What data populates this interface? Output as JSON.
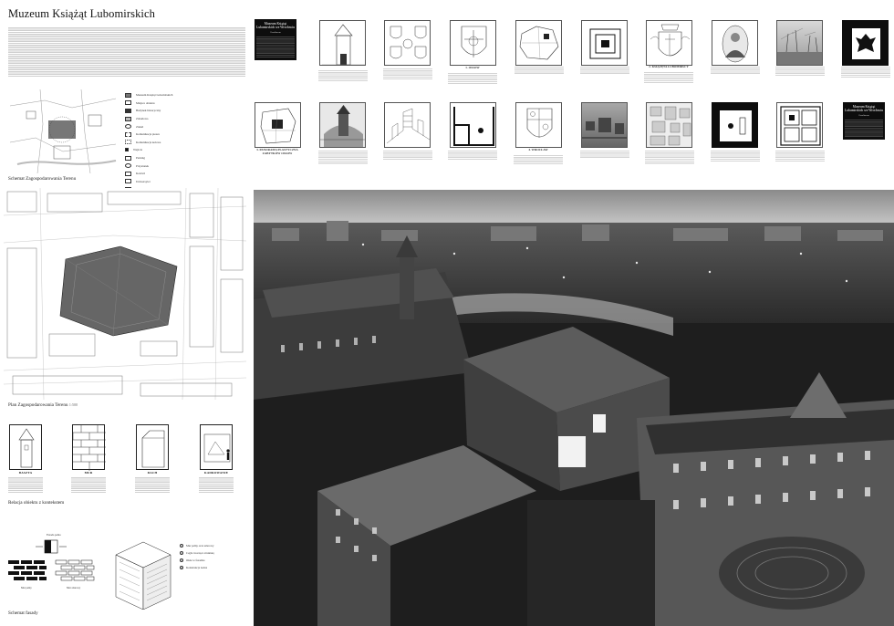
{
  "poster": {
    "title": "Muzeum Książąt Lubomirskich",
    "intro_placeholder": "Wprowadzenie / tekst opisowy"
  },
  "left": {
    "schemat_caption": "Schemat  Zagospodarowania Terenu",
    "plan_caption": "Plan Zagospodarowania Terenu",
    "plan_scale": "1:500",
    "relacja_caption": "Relacja obiektu z kontekstem",
    "facade_caption": "Schemat fasady",
    "legend": [
      {
        "label": "Muzeum Książąt Lubomirskich"
      },
      {
        "label": "Miejsce obiektu"
      },
      {
        "label": "Budynek historyczny"
      },
      {
        "label": "Zabudowa"
      },
      {
        "label": "Zieleń"
      },
      {
        "label": "Komunikacja piesza"
      },
      {
        "label": "Komunikacja kołowa"
      },
      {
        "label": "Wejście"
      },
      {
        "label": "Parking"
      },
      {
        "label": "Przystanek"
      },
      {
        "label": "Kościół"
      },
      {
        "label": "Uniwersytet"
      },
      {
        "label": "Rzeka Odra"
      },
      {
        "label": "Osie widokowe"
      }
    ],
    "relation_tiles": [
      {
        "label": "BASZTA"
      },
      {
        "label": "MUR"
      },
      {
        "label": "DACH"
      },
      {
        "label": "KADROWANIE"
      }
    ],
    "facade_notes": [
      {
        "num": "1",
        "text": "Mur pełny oraz ażurowy"
      },
      {
        "num": "2",
        "text": "Cegła tworząca strukturę"
      },
      {
        "num": "3",
        "text": "Okna w fasadzie"
      },
      {
        "num": "4",
        "text": "Konstrukcja nośna"
      }
    ],
    "facade_top_label": "Fasada pełna",
    "facade_bottom_left": "Mur pełny",
    "facade_bottom_right": "Mur ażurowy"
  },
  "top_row": [
    {
      "kind": "tower",
      "caption": ""
    },
    {
      "kind": "crests",
      "caption": ""
    },
    {
      "kind": "crest",
      "caption": "1. OSSOW"
    },
    {
      "kind": "map",
      "caption": ""
    },
    {
      "kind": "square-dark",
      "caption": ""
    },
    {
      "kind": "crest2",
      "caption": "2. KSIĄŻĘTA LUBOMIRSCY"
    },
    {
      "kind": "portrait",
      "caption": ""
    },
    {
      "kind": "photo",
      "caption": ""
    },
    {
      "kind": "eagle",
      "caption": ""
    }
  ],
  "bottom_row": [
    {
      "kind": "plan",
      "caption": "3. PANORAMA PLASTYCZNA ZABYTKÓW OSSOW"
    },
    {
      "kind": "painting",
      "caption": ""
    },
    {
      "kind": "sketch",
      "caption": ""
    },
    {
      "kind": "section",
      "caption": ""
    },
    {
      "kind": "crest3",
      "caption": "4. WROCŁAW"
    },
    {
      "kind": "aerial",
      "caption": ""
    },
    {
      "kind": "cityplan",
      "caption": ""
    },
    {
      "kind": "dot-dark",
      "caption": ""
    },
    {
      "kind": "grid-dark",
      "caption": ""
    }
  ],
  "museum_card_top": {
    "title": "Muzeum Książąt Lubomirskich we Wrocławiu",
    "sub": "Ossolineum"
  },
  "museum_card_bottom": {
    "title": "Muzeum Książąt Lubomirskich we Wrocławiu",
    "sub": "Ossolineum"
  },
  "colors": {
    "ink": "#111111",
    "dark_tile": "#0d0d0d",
    "photo_sky": "#b9b9b9"
  }
}
